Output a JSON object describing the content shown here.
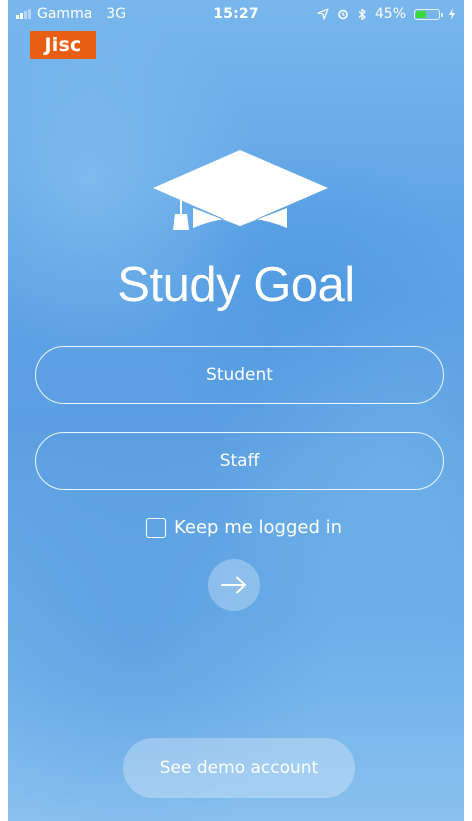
{
  "status_bar": {
    "carrier": "Gamma",
    "network": "3G",
    "time": "15:27",
    "battery_percent": "45%",
    "battery_level": 0.45,
    "icons": [
      "signal-icon",
      "location-icon",
      "alarm-icon",
      "bluetooth-icon",
      "battery-icon",
      "charging-icon"
    ]
  },
  "brand": {
    "logo_text": "Jisc",
    "logo_color": "#e85e13"
  },
  "app": {
    "title": "Study Goal",
    "icon": "graduation-cap-icon"
  },
  "login": {
    "student_label": "Student",
    "staff_label": "Staff",
    "keep_logged_in_label": "Keep me logged in",
    "keep_logged_in_checked": false,
    "continue_icon": "arrow-right-icon"
  },
  "footer": {
    "demo_label": "See demo account"
  },
  "colors": {
    "background": "#5ea4e6",
    "text": "#ffffff",
    "battery_fill": "#39d939"
  }
}
